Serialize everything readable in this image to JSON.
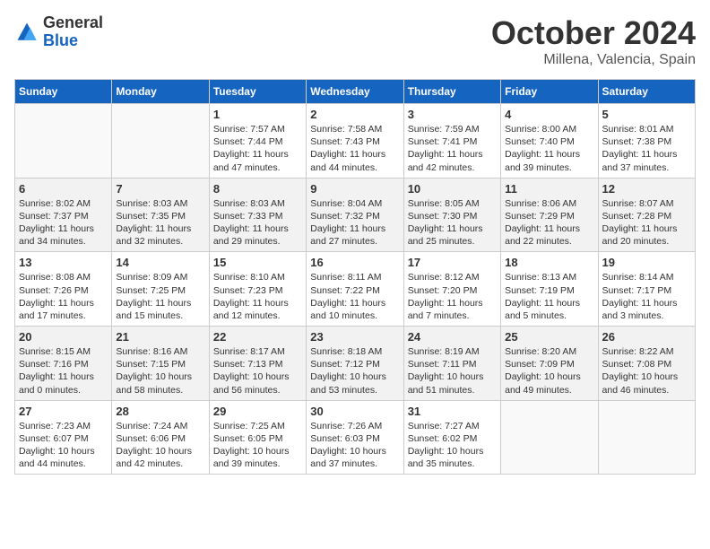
{
  "header": {
    "logo_line1": "General",
    "logo_line2": "Blue",
    "month": "October 2024",
    "location": "Millena, Valencia, Spain"
  },
  "columns": [
    "Sunday",
    "Monday",
    "Tuesday",
    "Wednesday",
    "Thursday",
    "Friday",
    "Saturday"
  ],
  "weeks": [
    [
      {
        "day": "",
        "content": ""
      },
      {
        "day": "",
        "content": ""
      },
      {
        "day": "1",
        "content": "Sunrise: 7:57 AM\nSunset: 7:44 PM\nDaylight: 11 hours and 47 minutes."
      },
      {
        "day": "2",
        "content": "Sunrise: 7:58 AM\nSunset: 7:43 PM\nDaylight: 11 hours and 44 minutes."
      },
      {
        "day": "3",
        "content": "Sunrise: 7:59 AM\nSunset: 7:41 PM\nDaylight: 11 hours and 42 minutes."
      },
      {
        "day": "4",
        "content": "Sunrise: 8:00 AM\nSunset: 7:40 PM\nDaylight: 11 hours and 39 minutes."
      },
      {
        "day": "5",
        "content": "Sunrise: 8:01 AM\nSunset: 7:38 PM\nDaylight: 11 hours and 37 minutes."
      }
    ],
    [
      {
        "day": "6",
        "content": "Sunrise: 8:02 AM\nSunset: 7:37 PM\nDaylight: 11 hours and 34 minutes."
      },
      {
        "day": "7",
        "content": "Sunrise: 8:03 AM\nSunset: 7:35 PM\nDaylight: 11 hours and 32 minutes."
      },
      {
        "day": "8",
        "content": "Sunrise: 8:03 AM\nSunset: 7:33 PM\nDaylight: 11 hours and 29 minutes."
      },
      {
        "day": "9",
        "content": "Sunrise: 8:04 AM\nSunset: 7:32 PM\nDaylight: 11 hours and 27 minutes."
      },
      {
        "day": "10",
        "content": "Sunrise: 8:05 AM\nSunset: 7:30 PM\nDaylight: 11 hours and 25 minutes."
      },
      {
        "day": "11",
        "content": "Sunrise: 8:06 AM\nSunset: 7:29 PM\nDaylight: 11 hours and 22 minutes."
      },
      {
        "day": "12",
        "content": "Sunrise: 8:07 AM\nSunset: 7:28 PM\nDaylight: 11 hours and 20 minutes."
      }
    ],
    [
      {
        "day": "13",
        "content": "Sunrise: 8:08 AM\nSunset: 7:26 PM\nDaylight: 11 hours and 17 minutes."
      },
      {
        "day": "14",
        "content": "Sunrise: 8:09 AM\nSunset: 7:25 PM\nDaylight: 11 hours and 15 minutes."
      },
      {
        "day": "15",
        "content": "Sunrise: 8:10 AM\nSunset: 7:23 PM\nDaylight: 11 hours and 12 minutes."
      },
      {
        "day": "16",
        "content": "Sunrise: 8:11 AM\nSunset: 7:22 PM\nDaylight: 11 hours and 10 minutes."
      },
      {
        "day": "17",
        "content": "Sunrise: 8:12 AM\nSunset: 7:20 PM\nDaylight: 11 hours and 7 minutes."
      },
      {
        "day": "18",
        "content": "Sunrise: 8:13 AM\nSunset: 7:19 PM\nDaylight: 11 hours and 5 minutes."
      },
      {
        "day": "19",
        "content": "Sunrise: 8:14 AM\nSunset: 7:17 PM\nDaylight: 11 hours and 3 minutes."
      }
    ],
    [
      {
        "day": "20",
        "content": "Sunrise: 8:15 AM\nSunset: 7:16 PM\nDaylight: 11 hours and 0 minutes."
      },
      {
        "day": "21",
        "content": "Sunrise: 8:16 AM\nSunset: 7:15 PM\nDaylight: 10 hours and 58 minutes."
      },
      {
        "day": "22",
        "content": "Sunrise: 8:17 AM\nSunset: 7:13 PM\nDaylight: 10 hours and 56 minutes."
      },
      {
        "day": "23",
        "content": "Sunrise: 8:18 AM\nSunset: 7:12 PM\nDaylight: 10 hours and 53 minutes."
      },
      {
        "day": "24",
        "content": "Sunrise: 8:19 AM\nSunset: 7:11 PM\nDaylight: 10 hours and 51 minutes."
      },
      {
        "day": "25",
        "content": "Sunrise: 8:20 AM\nSunset: 7:09 PM\nDaylight: 10 hours and 49 minutes."
      },
      {
        "day": "26",
        "content": "Sunrise: 8:22 AM\nSunset: 7:08 PM\nDaylight: 10 hours and 46 minutes."
      }
    ],
    [
      {
        "day": "27",
        "content": "Sunrise: 7:23 AM\nSunset: 6:07 PM\nDaylight: 10 hours and 44 minutes."
      },
      {
        "day": "28",
        "content": "Sunrise: 7:24 AM\nSunset: 6:06 PM\nDaylight: 10 hours and 42 minutes."
      },
      {
        "day": "29",
        "content": "Sunrise: 7:25 AM\nSunset: 6:05 PM\nDaylight: 10 hours and 39 minutes."
      },
      {
        "day": "30",
        "content": "Sunrise: 7:26 AM\nSunset: 6:03 PM\nDaylight: 10 hours and 37 minutes."
      },
      {
        "day": "31",
        "content": "Sunrise: 7:27 AM\nSunset: 6:02 PM\nDaylight: 10 hours and 35 minutes."
      },
      {
        "day": "",
        "content": ""
      },
      {
        "day": "",
        "content": ""
      }
    ]
  ]
}
